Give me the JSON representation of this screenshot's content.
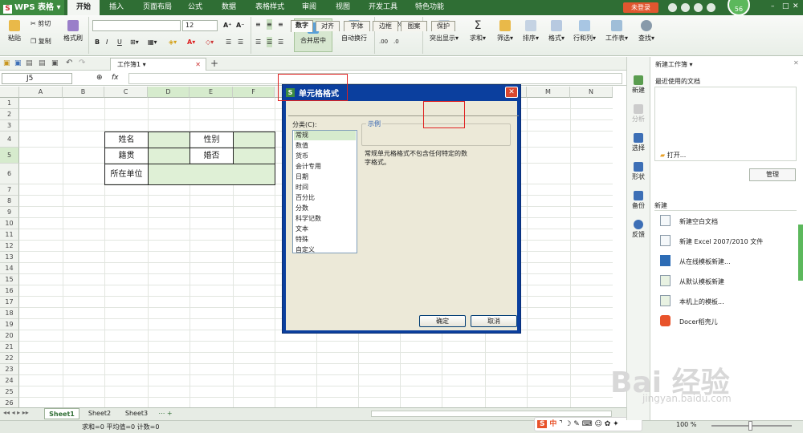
{
  "app": {
    "name": "WPS 表格",
    "login": "未登录",
    "badge": "56"
  },
  "menu": [
    "开始",
    "插入",
    "页面布局",
    "公式",
    "数据",
    "表格样式",
    "审阅",
    "视图",
    "开发工具",
    "特色功能"
  ],
  "ribbon": {
    "paste": "粘贴",
    "cut": "剪切",
    "copy": "复制",
    "format_painter": "格式刷",
    "font_name": "",
    "font_size": "12",
    "bold": "B",
    "italic": "I",
    "underline": "U",
    "merge": "合并居中",
    "wrap": "自动换行",
    "percent": "%",
    "highlight": "突出显示",
    "sum": "求和",
    "filter": "筛选",
    "sort": "排序",
    "style": "格式",
    "rowcol": "行和列",
    "sheet": "工作表",
    "find": "查找"
  },
  "doc": {
    "tab_name": "工作簿1"
  },
  "formula": {
    "cell_ref": "J5",
    "fx": "fx",
    "value": ""
  },
  "grid": {
    "columns": [
      "A",
      "B",
      "C",
      "D",
      "E",
      "F",
      "G",
      "H",
      "I",
      "J",
      "K",
      "L",
      "M",
      "N"
    ],
    "rows": [
      "1",
      "2",
      "3",
      "4",
      "5",
      "6",
      "7",
      "8",
      "9",
      "10",
      "11",
      "12",
      "13",
      "14",
      "15",
      "16",
      "17",
      "18",
      "19",
      "20",
      "21",
      "22",
      "23",
      "24",
      "25",
      "26",
      "27"
    ],
    "cells": {
      "c4": "姓名",
      "e4": "性别",
      "c5": "籍贯",
      "e5": "婚否",
      "c6": "所在单位"
    }
  },
  "sheets": [
    "Sheet1",
    "Sheet2",
    "Sheet3"
  ],
  "status": {
    "text": "求和=0  平均值=0  计数=0",
    "zoom": "100 %"
  },
  "vtools": [
    "新建",
    "分析",
    "选择",
    "形状",
    "备份",
    "反馈"
  ],
  "panel": {
    "title": "新建工作簿",
    "recent": "最近使用的文档",
    "open": "打开...",
    "manage": "管理",
    "new_header": "新建",
    "items": [
      "新建空白文档",
      "新建 Excel 2007/2010 文件",
      "从在线模板新建...",
      "从默认模板新建",
      "本机上的模板...",
      "Docer稻壳儿"
    ]
  },
  "dialog": {
    "title": "单元格格式",
    "tabs": [
      "数字",
      "对齐",
      "字体",
      "边框",
      "图案",
      "保护"
    ],
    "category_label": "分类(C):",
    "categories": [
      "常规",
      "数值",
      "货币",
      "会计专用",
      "日期",
      "时间",
      "百分比",
      "分数",
      "科学记数",
      "文本",
      "特殊",
      "自定义"
    ],
    "sample_label": "示例",
    "description": "常规单元格格式不包含任何特定的数字格式。",
    "ok": "确定",
    "cancel": "取消"
  },
  "watermark": {
    "main": "Bai 经验",
    "url": "jingyan.baidu.com"
  },
  "colors": {
    "menu_green": "#2f6e34",
    "selection_green": "#d6ebcd",
    "dialog_blue": "#0b3f9e",
    "highlight_red": "#e02020"
  }
}
